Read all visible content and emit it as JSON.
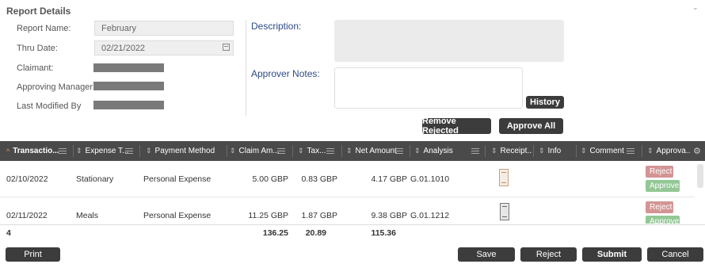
{
  "header": {
    "title": "Report Details",
    "collapse_icon": "chevron-down-icon"
  },
  "form": {
    "report_name_label": "Report Name:",
    "report_name_value": "February",
    "thru_date_label": "Thru Date:",
    "thru_date_value": "02/21/2022",
    "claimant_label": "Claimant:",
    "approving_manager_label": "Approving Manager:",
    "last_modified_label": "Last Modified By",
    "description_label": "Description:",
    "approver_notes_label": "Approver Notes:"
  },
  "buttons": {
    "history": "History",
    "remove_rejected": "Remove Rejected",
    "approve_all": "Approve All",
    "print": "Print",
    "save": "Save",
    "reject": "Reject",
    "submit": "Submit",
    "cancel": "Cancel"
  },
  "table": {
    "columns": [
      "Transactio...",
      "Expense T...",
      "Payment Method",
      "Claim Am...",
      "Tax...",
      "Net Amount",
      "Analysis",
      "Receipt...",
      "Info",
      "Comment",
      "Approva..."
    ],
    "rows": [
      {
        "date": "02/10/2022",
        "expense_type": "Stationary",
        "payment_method": "Personal Expense",
        "claim_amount": "5.00 GBP",
        "tax": "0.83 GBP",
        "net_amount": "4.17 GBP",
        "analysis": "G.01.1010",
        "reject_label": "Reject",
        "approve_label": "Approve"
      },
      {
        "date": "02/11/2022",
        "expense_type": "Meals",
        "payment_method": "Personal Expense",
        "claim_amount": "11.25 GBP",
        "tax": "1.87 GBP",
        "net_amount": "9.38 GBP",
        "analysis": "G.01.1212",
        "reject_label": "Reject",
        "approve_label": "Approve"
      }
    ],
    "totals": {
      "count": "4",
      "claim_amount": "136.25",
      "tax": "20.89",
      "net_amount": "115.36"
    }
  },
  "colors": {
    "header_bg": "#4a4a4a",
    "label_blue": "#2e4a87",
    "reject_badge": "#d49494",
    "approve_badge": "#93c795",
    "dark_button": "#3c3c3c"
  }
}
